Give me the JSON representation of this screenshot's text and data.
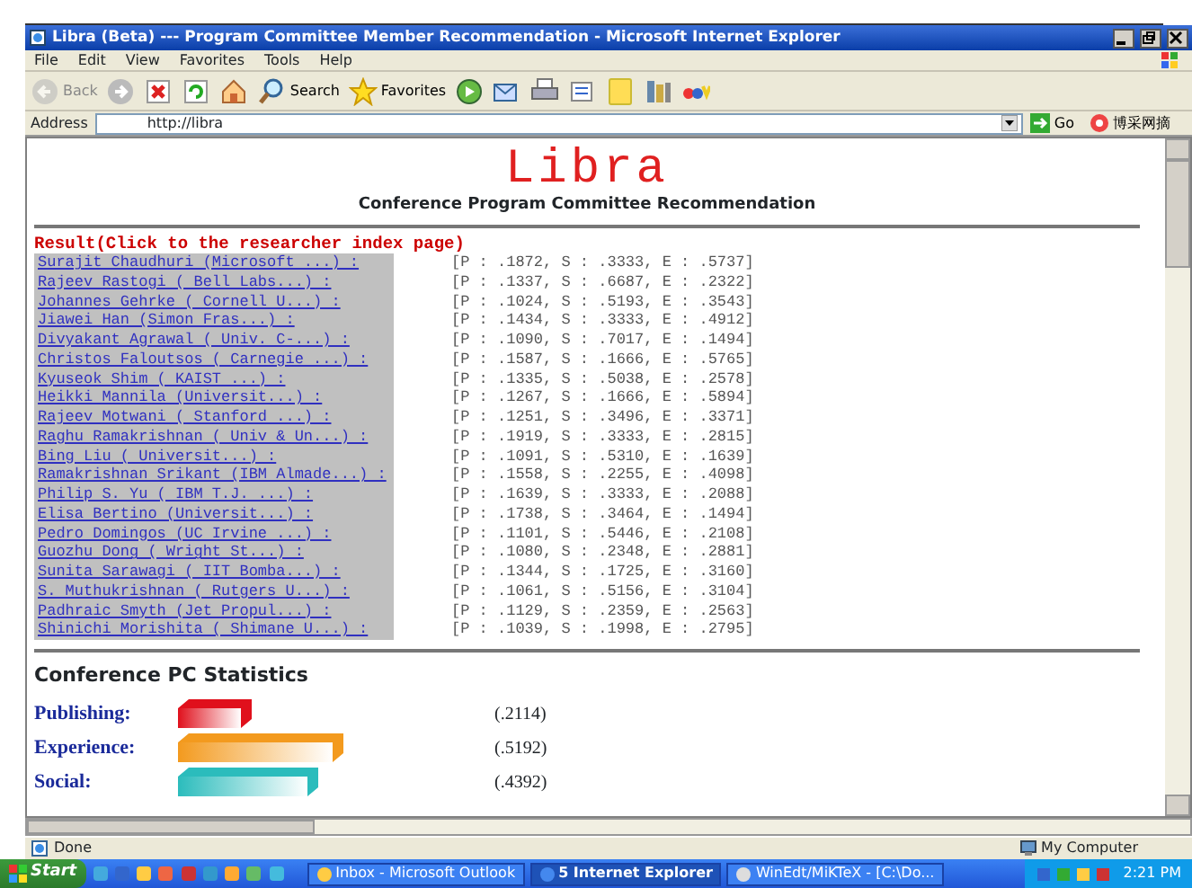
{
  "window": {
    "title": "Libra (Beta) --- Program Committee Member Recommendation - Microsoft Internet Explorer"
  },
  "menu": [
    "File",
    "Edit",
    "View",
    "Favorites",
    "Tools",
    "Help"
  ],
  "toolbar": [
    {
      "kind": "back",
      "label": "Back",
      "disabled": true
    },
    {
      "kind": "forward",
      "disabled": false
    },
    {
      "kind": "stop",
      "disabled": false
    },
    {
      "kind": "refresh",
      "disabled": false
    },
    {
      "kind": "home",
      "disabled": false
    },
    {
      "kind": "search",
      "label": "Search",
      "disabled": false
    },
    {
      "kind": "favorites",
      "label": "Favorites",
      "disabled": false
    },
    {
      "kind": "media",
      "disabled": false
    },
    {
      "kind": "mail",
      "disabled": false
    },
    {
      "kind": "print",
      "disabled": false
    },
    {
      "kind": "edit",
      "disabled": false
    },
    {
      "kind": "notes",
      "disabled": false
    },
    {
      "kind": "research",
      "disabled": false
    },
    {
      "kind": "ebay",
      "disabled": false
    }
  ],
  "address": {
    "label": "Address",
    "value": "http://libra",
    "go": "Go",
    "extra": "博采网摘"
  },
  "page": {
    "logo": "Libra",
    "subtitle": "Conference Program Committee Recommendation",
    "result_heading": "Result(Click to the researcher index page)",
    "researchers": [
      {
        "name": "Surajit Chaudhuri (Microsoft ...) :",
        "score": "[P : .1872, S : .3333, E : .5737]"
      },
      {
        "name": "Rajeev Rastogi ( Bell Labs...) :",
        "score": "[P : .1337, S : .6687, E : .2322]"
      },
      {
        "name": "Johannes Gehrke ( Cornell U...) :",
        "score": "[P : .1024, S : .5193, E : .3543]"
      },
      {
        "name": "Jiawei Han (Simon Fras...) :",
        "score": "[P : .1434, S : .3333, E : .4912]"
      },
      {
        "name": "Divyakant Agrawal ( Univ. C-...) :",
        "score": "[P : .1090, S : .7017, E : .1494]"
      },
      {
        "name": "Christos Faloutsos ( Carnegie ...) :",
        "score": "[P : .1587, S : .1666, E : .5765]"
      },
      {
        "name": "Kyuseok Shim ( KAIST ...) :",
        "score": "[P : .1335, S : .5038, E : .2578]"
      },
      {
        "name": "Heikki Mannila (Universit...) :",
        "score": "[P : .1267, S : .1666, E : .5894]"
      },
      {
        "name": "Rajeev Motwani ( Stanford ...) :",
        "score": "[P : .1251, S : .3496, E : .3371]"
      },
      {
        "name": "Raghu Ramakrishnan ( Univ & Un...) :",
        "score": "[P : .1919, S : .3333, E : .2815]"
      },
      {
        "name": "Bing Liu ( Universit...) :",
        "score": "[P : .1091, S : .5310, E : .1639]"
      },
      {
        "name": "Ramakrishnan Srikant (IBM Almade...) :",
        "score": "[P : .1558, S : .2255, E : .4098]"
      },
      {
        "name": "Philip S. Yu ( IBM T.J. ...) :",
        "score": "[P : .1639, S : .3333, E : .2088]"
      },
      {
        "name": "Elisa Bertino (Universit...) :",
        "score": "[P : .1738, S : .3464, E : .1494]"
      },
      {
        "name": "Pedro Domingos (UC Irvine ...) :",
        "score": "[P : .1101, S : .5446, E : .2108]"
      },
      {
        "name": "Guozhu Dong ( Wright St...) :",
        "score": "[P : .1080, S : .2348, E : .2881]"
      },
      {
        "name": "Sunita Sarawagi ( IIT Bomba...) :",
        "score": "[P : .1344, S : .1725, E : .3160]"
      },
      {
        "name": "S. Muthukrishnan ( Rutgers U...) :",
        "score": "[P : .1061, S : .5156, E : .3104]"
      },
      {
        "name": "Padhraic Smyth (Jet Propul...) :",
        "score": "[P : .1129, S : .2359, E : .2563]"
      },
      {
        "name": "Shinichi Morishita ( Shimane U...) :",
        "score": "[P : .1039, S : .1998, E : .2795]"
      }
    ],
    "stats": {
      "title": "Conference PC Statistics",
      "metrics": [
        {
          "label": "Publishing:",
          "level": 0.2114,
          "reading": "(.2114)",
          "color": "#e0101c"
        },
        {
          "label": "Experience:",
          "level": 0.5192,
          "reading": "(.5192)",
          "color": "#f39a1e"
        },
        {
          "label": "Social:",
          "level": 0.4392,
          "reading": "(.4392)",
          "color": "#2bbcbc"
        }
      ]
    }
  },
  "status_bar": {
    "text": "Done",
    "zone": "My Computer"
  },
  "taskbar": {
    "start": "Start",
    "tasks": [
      {
        "label": "Inbox - Microsoft Outlook",
        "kind": "outlook",
        "selected": false
      },
      {
        "label": "5 Internet Explorer",
        "kind": "ie",
        "selected": true
      },
      {
        "label": "WinEdt/MiKTeX - [C:\\Do...",
        "kind": "winedt",
        "selected": false
      }
    ],
    "clock": "2:21 PM"
  }
}
